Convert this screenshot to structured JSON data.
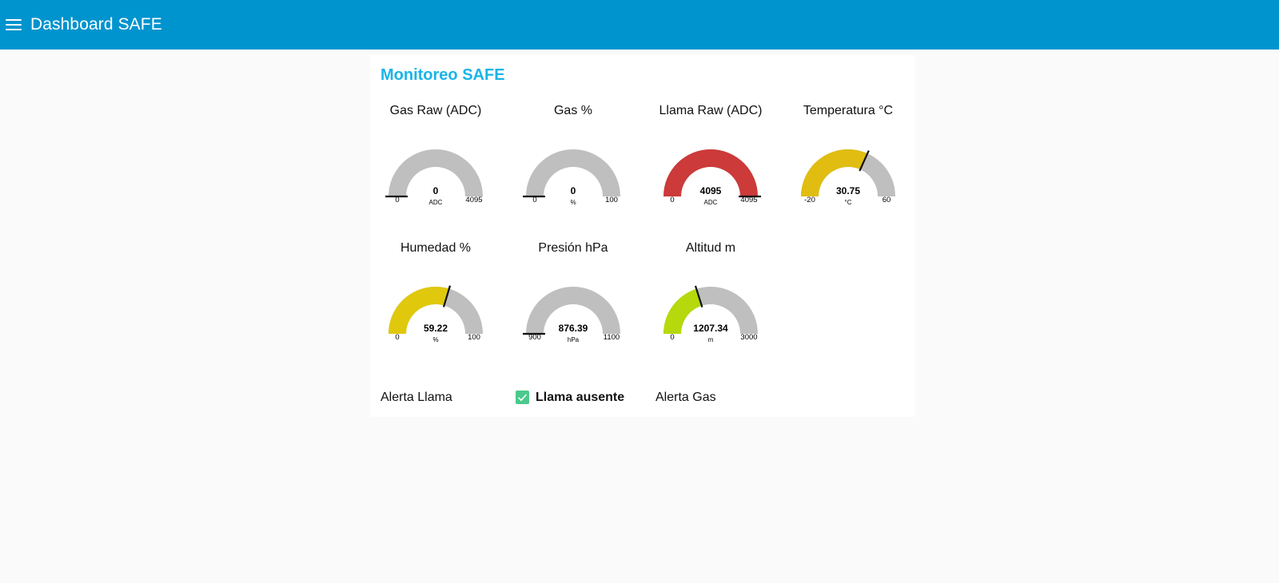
{
  "header": {
    "title": "Dashboard SAFE"
  },
  "group": {
    "title": "Monitoreo SAFE"
  },
  "gauges": [
    {
      "label": "Gas Raw (ADC)",
      "value": 0,
      "value_text": "0",
      "units": "ADC",
      "min": 0,
      "max": 4095,
      "min_text": "0",
      "max_text": "4095",
      "color": "#bfbfbf"
    },
    {
      "label": "Gas %",
      "value": 0,
      "value_text": "0",
      "units": "%",
      "min": 0,
      "max": 100,
      "min_text": "0",
      "max_text": "100",
      "color": "#bfbfbf"
    },
    {
      "label": "Llama Raw (ADC)",
      "value": 4095,
      "value_text": "4095",
      "units": "ADC",
      "min": 0,
      "max": 4095,
      "min_text": "0",
      "max_text": "4095",
      "color": "#cc3a3a"
    },
    {
      "label": "Temperatura °C",
      "value": 30.75,
      "value_text": "30.75",
      "units": "°C",
      "min": -20,
      "max": 60,
      "min_text": "-20",
      "max_text": "60",
      "color": "#e0bd10"
    },
    {
      "label": "Humedad %",
      "value": 59.22,
      "value_text": "59.22",
      "units": "%",
      "min": 0,
      "max": 100,
      "min_text": "0",
      "max_text": "100",
      "color": "#e0c80c"
    },
    {
      "label": "Presión hPa",
      "value": 876.39,
      "value_text": "876.39",
      "units": "hPa",
      "min": 900,
      "max": 1100,
      "min_text": "900",
      "max_text": "1100",
      "color": "#bfbfbf"
    },
    {
      "label": "Altitud m",
      "value": 1207.34,
      "value_text": "1207.34",
      "units": "m",
      "min": 0,
      "max": 3000,
      "min_text": "0",
      "max_text": "3000",
      "color": "#b5d90c"
    }
  ],
  "alerts": {
    "flame_label": "Alerta Llama",
    "flame_status": "Llama ausente",
    "gas_label": "Alerta Gas"
  },
  "colors": {
    "header_bg": "#0094ce",
    "group_title": "#1ab4e8",
    "gauge_track": "#bfbfbf",
    "check_bg": "#4bc98c"
  }
}
